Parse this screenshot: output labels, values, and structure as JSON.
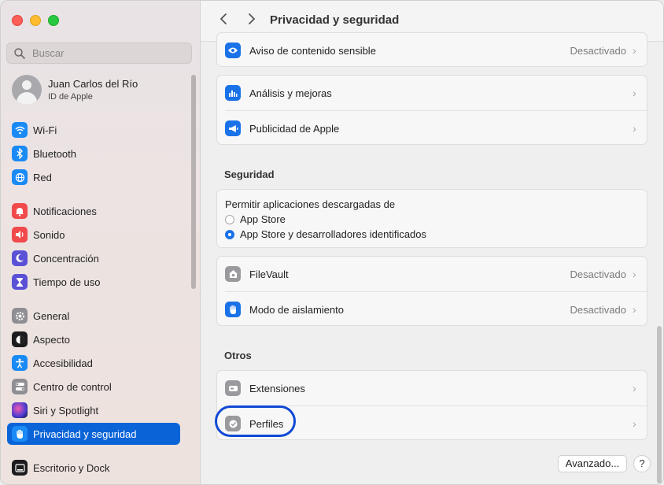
{
  "window": {
    "title": "Privacidad y seguridad"
  },
  "search": {
    "placeholder": "Buscar"
  },
  "account": {
    "name": "Juan Carlos del Río",
    "subtitle": "ID de Apple"
  },
  "sidebar": {
    "items": [
      {
        "label": "Wi-Fi",
        "icon": "wifi-icon",
        "color": "#1a8af5"
      },
      {
        "label": "Bluetooth",
        "icon": "bluetooth-icon",
        "color": "#1a8af5"
      },
      {
        "label": "Red",
        "icon": "globe-icon",
        "color": "#1a8af5"
      },
      {
        "label": "Notificaciones",
        "icon": "bell-icon",
        "color": "#f2494b"
      },
      {
        "label": "Sonido",
        "icon": "speaker-icon",
        "color": "#f2494b"
      },
      {
        "label": "Concentración",
        "icon": "moon-icon",
        "color": "#5a51d6"
      },
      {
        "label": "Tiempo de uso",
        "icon": "hourglass-icon",
        "color": "#5a51d6"
      },
      {
        "label": "General",
        "icon": "gear-icon",
        "color": "#8e8e93"
      },
      {
        "label": "Aspecto",
        "icon": "appearance-icon",
        "color": "#1c1c1e"
      },
      {
        "label": "Accesibilidad",
        "icon": "accessibility-icon",
        "color": "#1a8af5"
      },
      {
        "label": "Centro de control",
        "icon": "toggles-icon",
        "color": "#8e8e93"
      },
      {
        "label": "Siri y Spotlight",
        "icon": "siri-icon",
        "color": "#7a3ad0"
      },
      {
        "label": "Privacidad y seguridad",
        "icon": "hand-icon",
        "color": "#1a8af5",
        "selected": true
      },
      {
        "label": "Escritorio y Dock",
        "icon": "dock-icon",
        "color": "#1c1c1e"
      }
    ]
  },
  "main": {
    "rows_top": [
      {
        "label": "Aviso de contenido sensible",
        "value": "Desactivado",
        "icon": "eye-icon"
      },
      {
        "label": "Análisis y mejoras",
        "value": "",
        "icon": "chart-icon"
      },
      {
        "label": "Publicidad de Apple",
        "value": "",
        "icon": "megaphone-icon"
      }
    ],
    "seguridad": {
      "heading": "Seguridad",
      "allow_label": "Permitir aplicaciones descargadas de",
      "options": [
        {
          "label": "App Store",
          "selected": false
        },
        {
          "label": "App Store y desarrolladores identificados",
          "selected": true
        }
      ],
      "rows": [
        {
          "label": "FileVault",
          "value": "Desactivado",
          "icon": "house-lock-icon"
        },
        {
          "label": "Modo de aislamiento",
          "value": "Desactivado",
          "icon": "hand-icon"
        }
      ]
    },
    "otros": {
      "heading": "Otros",
      "rows": [
        {
          "label": "Extensiones",
          "value": "",
          "icon": "puzzle-icon"
        },
        {
          "label": "Perfiles",
          "value": "",
          "icon": "checkmark-badge-icon"
        }
      ]
    },
    "buttons": {
      "advanced": "Avanzado...",
      "help": "?"
    }
  }
}
